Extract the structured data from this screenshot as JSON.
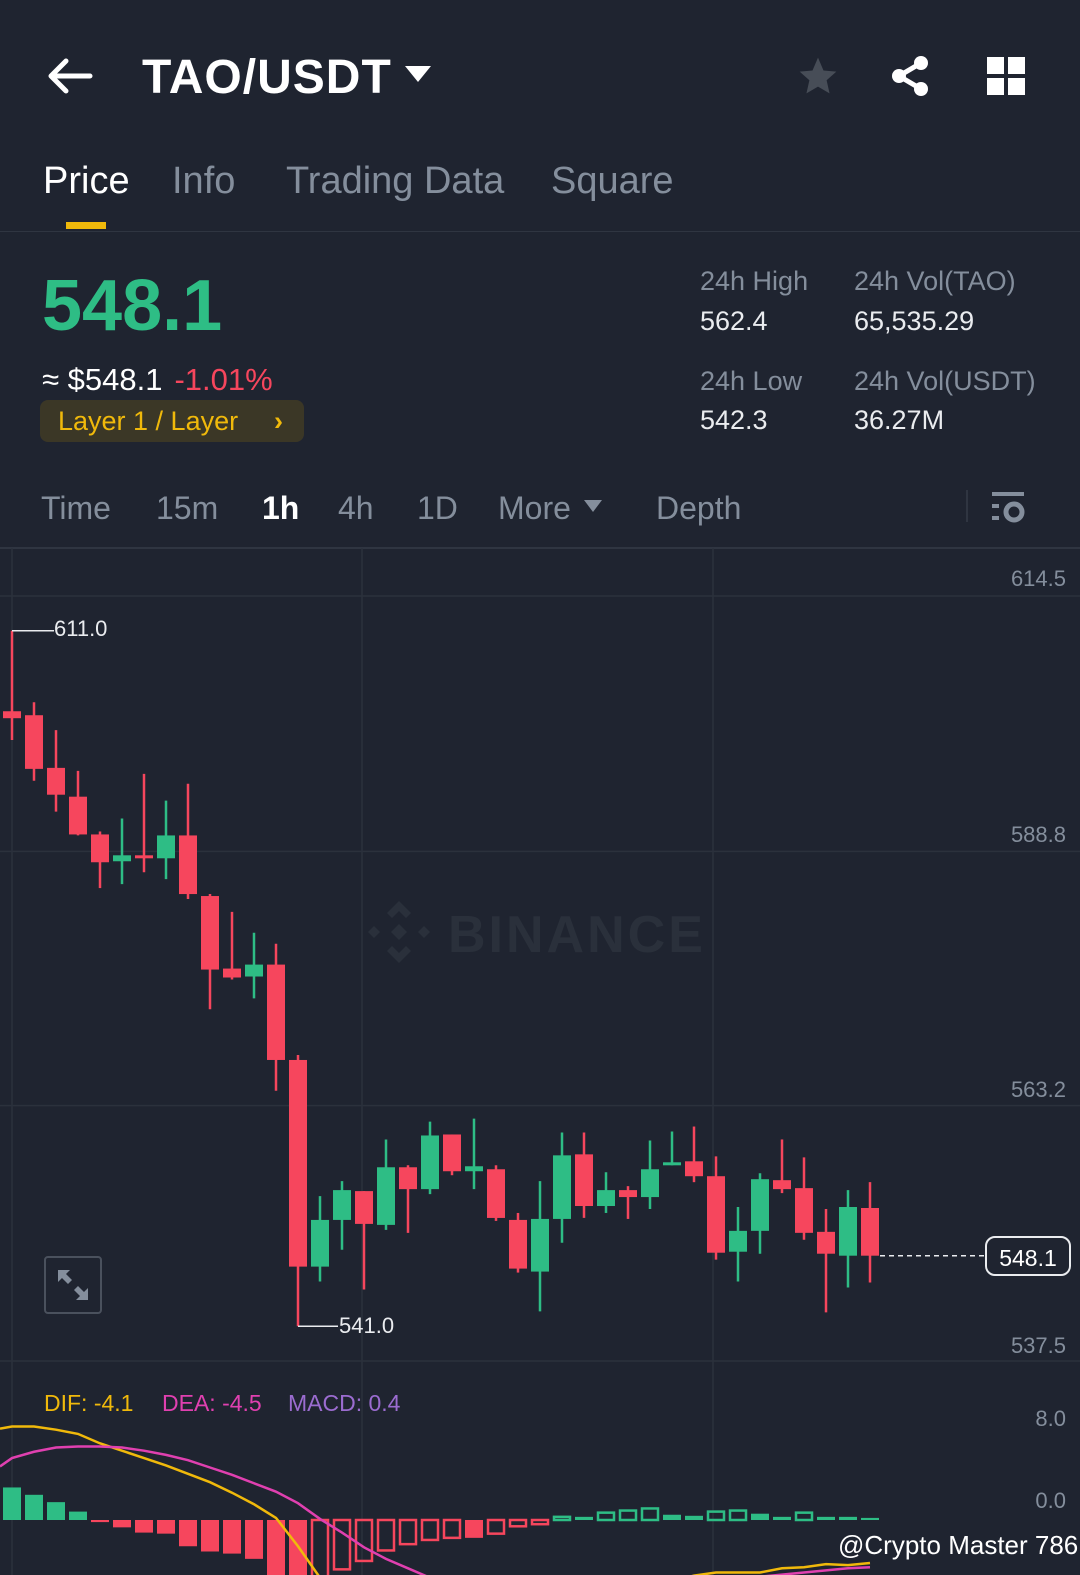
{
  "header": {
    "pair": "TAO/USDT"
  },
  "tabs": [
    {
      "label": "Price"
    },
    {
      "label": "Info"
    },
    {
      "label": "Trading Data"
    },
    {
      "label": "Square"
    }
  ],
  "ticker": {
    "last_price": "548.1",
    "usd_price": "≈ $548.1",
    "change_pct": "-1.01%",
    "tag": "Layer 1 / Layer",
    "stats": {
      "high_label": "24h High",
      "high": "562.4",
      "low_label": "24h Low",
      "low": "542.3",
      "vol_base_label": "24h Vol(TAO)",
      "vol_base": "65,535.29",
      "vol_quote_label": "24h Vol(USDT)",
      "vol_quote": "36.27M"
    }
  },
  "intervals": [
    {
      "label": "Time"
    },
    {
      "label": "15m"
    },
    {
      "label": "1h"
    },
    {
      "label": "4h"
    },
    {
      "label": "1D"
    },
    {
      "label": "More"
    },
    {
      "label": "Depth"
    }
  ],
  "colors": {
    "up": "#2ebd85",
    "down": "#f6465d",
    "accent": "#f0b90b",
    "dif": "#f0b90b",
    "dea": "#e040b0",
    "macd": "#9b6cd0"
  },
  "watermark": "BINANCE",
  "credit": "@Crypto Master 786",
  "chart_data": [
    {
      "type": "candlestick",
      "title": "TAO/USDT 1h",
      "interval": "1h",
      "y_ticks": [
        "614.5",
        "588.8",
        "563.2",
        "537.5"
      ],
      "ylim": [
        537.5,
        614.5
      ],
      "current_price": "548.1",
      "max_label": "611.0",
      "min_label": "541.0",
      "candles": [
        [
          602.9,
          611.0,
          600.0,
          602.2
        ],
        [
          602.5,
          603.8,
          595.9,
          597.1
        ],
        [
          597.2,
          601.0,
          592.8,
          594.5
        ],
        [
          594.3,
          596.9,
          590.4,
          590.5
        ],
        [
          590.5,
          590.8,
          585.1,
          587.7
        ],
        [
          587.8,
          592.1,
          585.5,
          588.4
        ],
        [
          588.4,
          596.6,
          586.7,
          588.2
        ],
        [
          588.1,
          593.9,
          586.0,
          590.4
        ],
        [
          590.4,
          595.6,
          584.0,
          584.5
        ],
        [
          584.3,
          584.5,
          572.9,
          576.9
        ],
        [
          577.0,
          582.7,
          575.9,
          576.1
        ],
        [
          576.2,
          580.6,
          574.0,
          577.4
        ],
        [
          577.4,
          579.5,
          564.7,
          567.8
        ],
        [
          567.8,
          568.3,
          541.0,
          547.0
        ],
        [
          547.0,
          554.1,
          545.5,
          551.7
        ],
        [
          551.7,
          555.6,
          548.7,
          554.7
        ],
        [
          554.6,
          554.6,
          544.7,
          551.3
        ],
        [
          551.2,
          559.8,
          550.7,
          557.0
        ],
        [
          557.0,
          557.2,
          550.4,
          554.8
        ],
        [
          554.8,
          561.6,
          554.3,
          560.2
        ],
        [
          560.3,
          560.3,
          556.2,
          556.6
        ],
        [
          556.6,
          561.9,
          554.8,
          557.1
        ],
        [
          556.8,
          557.2,
          551.6,
          551.9
        ],
        [
          551.7,
          552.4,
          546.4,
          546.8
        ],
        [
          546.5,
          555.6,
          542.5,
          551.8
        ],
        [
          551.8,
          560.5,
          549.4,
          558.2
        ],
        [
          558.3,
          560.5,
          551.9,
          553.1
        ],
        [
          553.1,
          556.5,
          552.4,
          554.7
        ],
        [
          554.7,
          555.1,
          551.8,
          554.0
        ],
        [
          554.0,
          559.7,
          552.8,
          556.8
        ],
        [
          557.2,
          560.6,
          557.2,
          557.5
        ],
        [
          557.6,
          561.1,
          555.5,
          556.1
        ],
        [
          556.1,
          558.1,
          547.7,
          548.4
        ],
        [
          548.5,
          553.0,
          545.5,
          550.6
        ],
        [
          550.6,
          556.4,
          548.3,
          555.8
        ],
        [
          555.7,
          559.8,
          554.4,
          554.8
        ],
        [
          554.9,
          558.0,
          549.7,
          550.4
        ],
        [
          550.5,
          552.8,
          542.4,
          548.3
        ],
        [
          548.1,
          554.7,
          544.9,
          553.0
        ],
        [
          552.9,
          555.5,
          545.4,
          548.1
        ]
      ]
    },
    {
      "type": "macd",
      "legend": {
        "dif": "DIF: -4.1",
        "dea": "DEA: -4.5",
        "macd": "MACD: 0.4"
      },
      "y_ticks": [
        "8.0",
        "0.0"
      ],
      "histogram": [
        3.1,
        2.4,
        1.7,
        0.8,
        -0.2,
        -0.7,
        -1.2,
        -1.3,
        -2.5,
        -3.0,
        -3.2,
        -3.7,
        -6.0,
        -7.0,
        -6.5,
        -4.7,
        -3.9,
        -2.9,
        -2.3,
        -1.9,
        -1.7,
        -1.7,
        -1.3,
        -0.6,
        -0.4,
        0.3,
        0.3,
        0.7,
        0.9,
        1.1,
        0.5,
        0.4,
        0.8,
        0.9,
        0.6,
        0.3,
        0.7,
        0.3,
        0.3,
        0.2
      ],
      "dif": [
        8.9,
        8.9,
        8.6,
        8.2,
        7.3,
        6.6,
        5.9,
        5.2,
        4.4,
        3.6,
        2.6,
        1.5,
        0.2,
        -2.5,
        -5.5,
        -7.5,
        -9.0,
        -10.0,
        -10.8,
        -11.2,
        -11.3,
        -11.2,
        -10.9,
        -10.6,
        -10.2,
        -9.6,
        -8.9,
        -8.2,
        -7.5,
        -6.8,
        -5.8,
        -5.3,
        -5.0,
        -5.0,
        -5.0,
        -4.6,
        -4.5,
        -4.2,
        -4.3,
        -4.1
      ],
      "dea": [
        5.9,
        6.5,
        6.9,
        7.0,
        7.0,
        6.9,
        6.6,
        6.2,
        5.7,
        5.0,
        4.3,
        3.5,
        2.7,
        1.6,
        0.1,
        -1.2,
        -2.6,
        -3.7,
        -4.6,
        -5.5,
        -6.3,
        -6.9,
        -7.4,
        -7.8,
        -8.0,
        -8.1,
        -8.0,
        -7.8,
        -7.5,
        -7.1,
        -6.7,
        -6.3,
        -6.0,
        -5.7,
        -5.4,
        -5.2,
        -5.0,
        -4.8,
        -4.6,
        -4.5
      ]
    }
  ]
}
